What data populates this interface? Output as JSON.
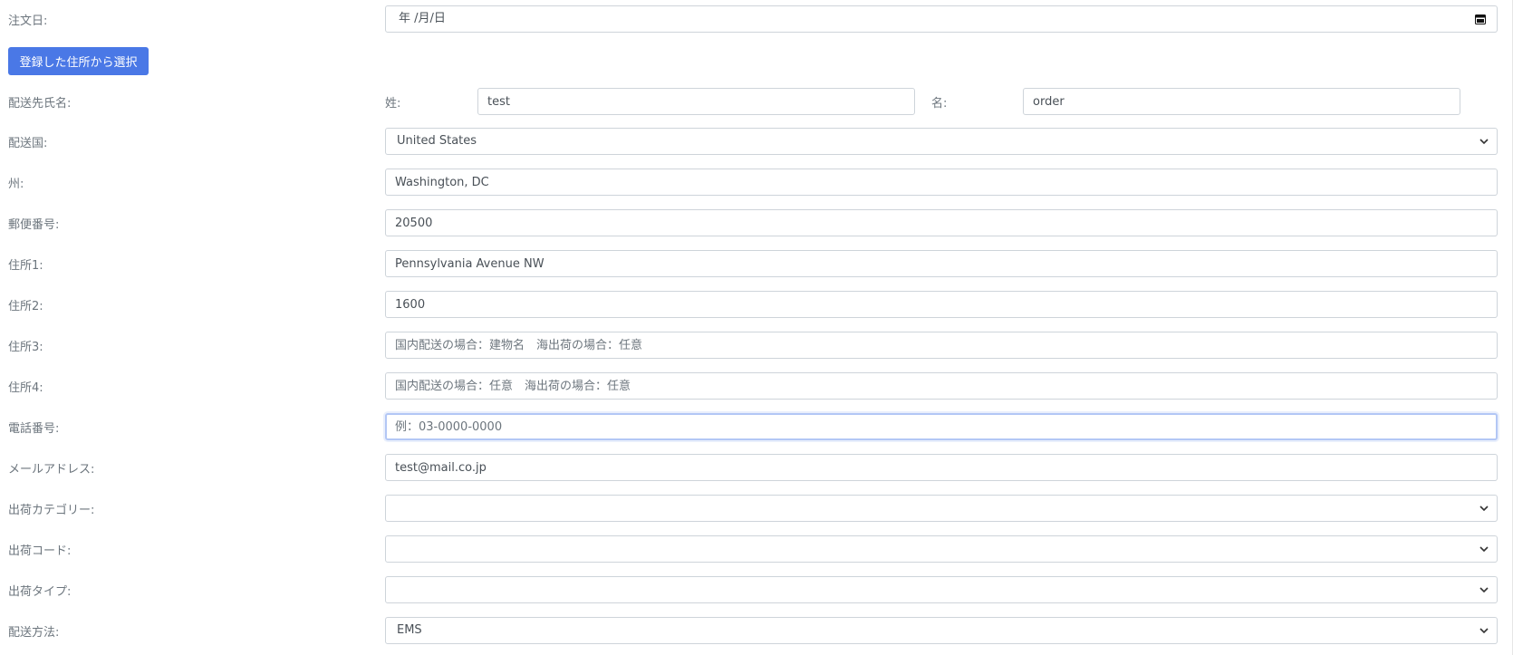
{
  "order_date": {
    "label": "注文日:",
    "value": "年 /月/日"
  },
  "select_address_button": "登録した住所から選択",
  "recipient_name": {
    "label": "配送先氏名:",
    "last_name_label": "姓:",
    "last_name_value": "test",
    "first_name_label": "名:",
    "first_name_value": "order"
  },
  "country": {
    "label": "配送国:",
    "value": "United States"
  },
  "state": {
    "label": "州:",
    "value": "Washington, DC"
  },
  "postal_code": {
    "label": "郵便番号:",
    "value": "20500"
  },
  "address1": {
    "label": "住所1:",
    "value": "Pennsylvania Avenue NW"
  },
  "address2": {
    "label": "住所2:",
    "value": "1600"
  },
  "address3": {
    "label": "住所3:",
    "placeholder": "国内配送の場合：建物名　海出荷の場合：任意"
  },
  "address4": {
    "label": "住所4:",
    "placeholder": "国内配送の場合：任意　海出荷の場合：任意"
  },
  "phone": {
    "label": "電話番号:",
    "placeholder": "例：03-0000-0000"
  },
  "email": {
    "label": "メールアドレス:",
    "value": "test@mail.co.jp"
  },
  "shipping_category": {
    "label": "出荷カテゴリー:",
    "value": ""
  },
  "shipping_code": {
    "label": "出荷コード:",
    "value": ""
  },
  "shipping_type": {
    "label": "出荷タイプ:",
    "value": ""
  },
  "shipping_method": {
    "label": "配送方法:",
    "value": "EMS"
  },
  "colors": {
    "primary_button": "#4a78e6",
    "border": "#ced4da",
    "focus_border": "#b3c7f5",
    "label_text": "#6c757d"
  }
}
